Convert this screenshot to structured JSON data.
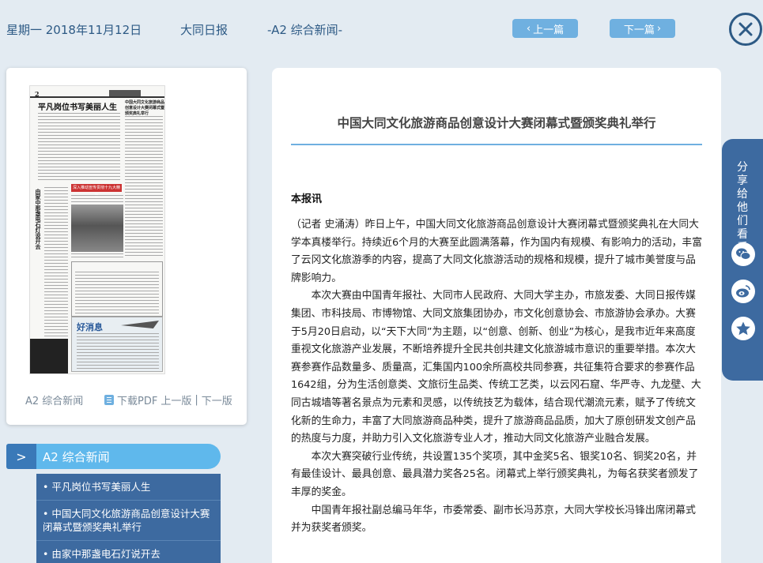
{
  "header": {
    "date": "星期一 2018年11月12日",
    "paper": "大同日报",
    "section": "-A2 综合新闻-",
    "prev_label": "上一篇",
    "next_label": "下一篇"
  },
  "thumbnail": {
    "page_number": "2",
    "page_headline": "平凡岗位书写美丽人生",
    "right_headline": "中国大同文化旅游商品创意设计大赛闭幕式暨颁奖典礼举行",
    "red_box": "深入推动宣传贯彻十九大精神",
    "vertical_headline": "由家中那盏电石灯说开去",
    "ad_title": "好消息",
    "label": "A2 综合新闻",
    "pdf_label": "下载PDF",
    "prev_page": "上一版",
    "next_page": "下一版",
    "separator": "|"
  },
  "section_nav": {
    "title": "A2  综合新闻",
    "items": [
      "• 平凡岗位书写美丽人生",
      "• 中国大同文化旅游商品创意设计大赛闭幕式暨颁奖典礼举行",
      "• 由家中那盏电石灯说开去"
    ]
  },
  "article": {
    "title": "中国大同文化旅游商品创意设计大赛闭幕式暨颁奖典礼举行",
    "lead": "本报讯",
    "paragraphs": [
      "（记者 史涌涛）昨日上午，中国大同文化旅游商品创意设计大赛闭幕式暨颁奖典礼在大同大学本真楼举行。持续近6个月的大赛至此圆满落幕，作为国内有规模、有影响力的活动，丰富了云冈文化旅游季的内容，提高了大同文化旅游活动的规格和规模，提升了城市美誉度与品牌影响力。",
      "本次大赛由中国青年报社、大同市人民政府、大同大学主办，市旅发委、大同日报传媒集团、市科技局、市博物馆、大同文旅集团协办，市文化创意协会、市旅游协会承办。大赛于5月20日启动，以“天下大同”为主题，以“创意、创新、创业”为核心，是我市近年来高度重视文化旅游产业发展，不断培养提升全民共创共建文化旅游城市意识的重要举措。本次大赛参赛作品数量多、质量高，汇集国内100余所高校共同参赛，共征集符合要求的参赛作品1642组，分为生活创意类、文旅衍生品类、传统工艺类，以云冈石窟、华严寺、九龙壁、大同古城墙等著名景点为元素和灵感，以传统技艺为载体，结合现代潮流元素，赋予了传统文化新的生命力，丰富了大同旅游商品种类，提升了旅游商品品质，加大了原创研发文创产品的热度与力度，并助力引入文化旅游专业人才，推动大同文化旅游产业融合发展。",
      "本次大赛突破行业传统，共设置135个奖项，其中金奖5名、银奖10名、铜奖20名，并有最佳设计、最具创意、最具潜力奖各25名。闭幕式上举行颁奖典礼，为每名获奖者颁发了丰厚的奖金。",
      "中国青年报社副总编马年华，市委常委、副市长冯苏京，大同大学校长冯锋出席闭幕式并为获奖者颁奖。"
    ]
  },
  "share": {
    "label": "分享给他们看看",
    "icons": [
      "wechat-icon",
      "weibo-icon",
      "star-icon"
    ]
  },
  "colors": {
    "background": "#e3ebf2",
    "accent": "#6fb0e0",
    "dark_blue": "#3d6aa0",
    "header_text": "#2d5a85"
  }
}
